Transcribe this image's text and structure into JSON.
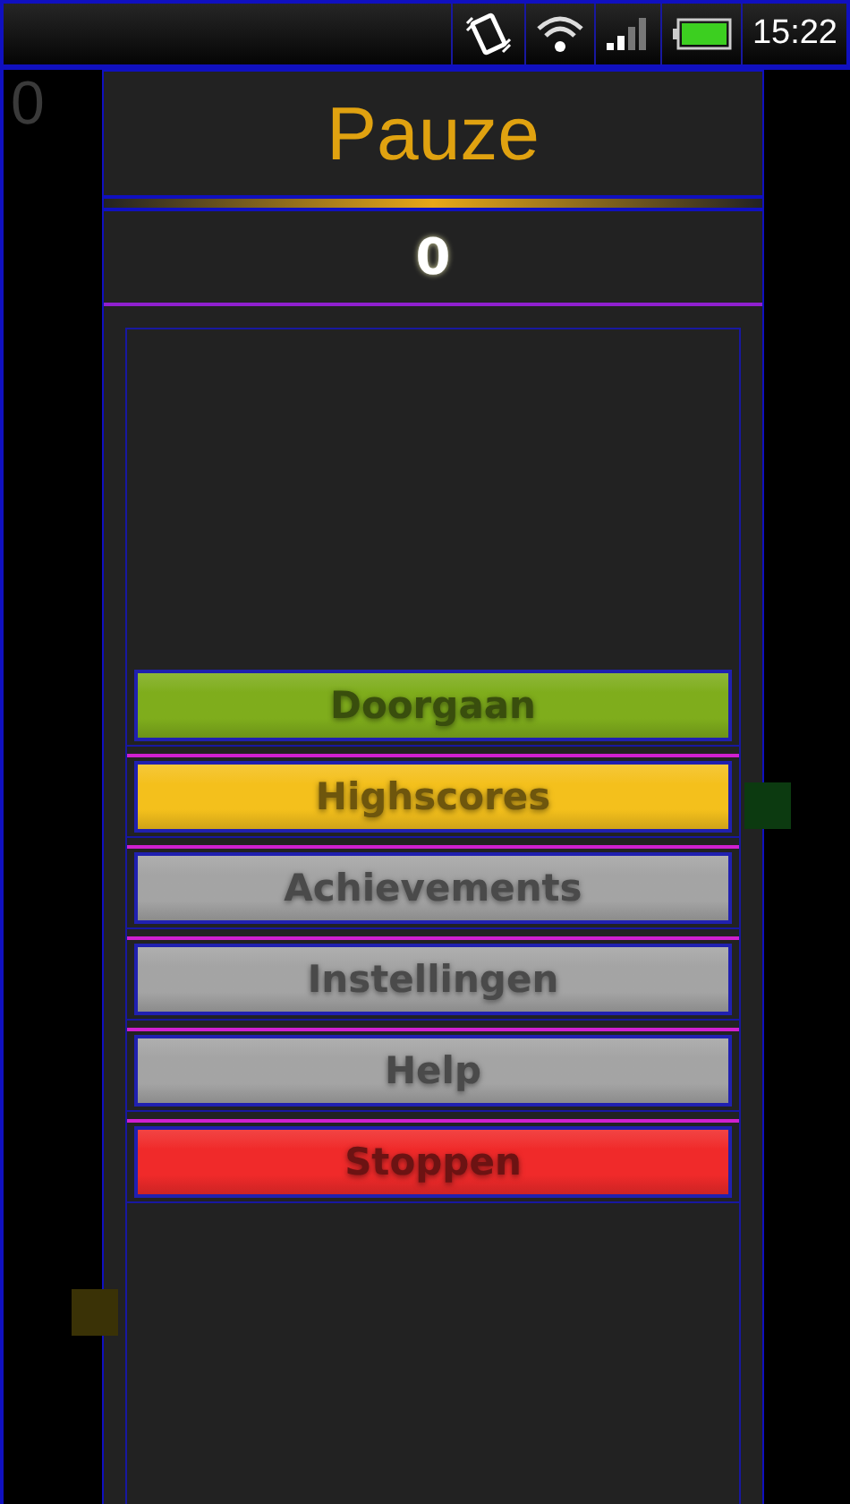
{
  "status_bar": {
    "time": "15:22"
  },
  "side_score": "0",
  "title": "Pauze",
  "score": "0",
  "menu": [
    {
      "label": "Doorgaan",
      "color": "#7fad1c"
    },
    {
      "label": "Highscores",
      "color": "#f4c01c"
    },
    {
      "label": "Achievements",
      "color": "#a4a4a4"
    },
    {
      "label": "Instellingen",
      "color": "#a4a4a4"
    },
    {
      "label": "Help",
      "color": "#a4a4a4"
    },
    {
      "label": "Stoppen",
      "color": "#f02a2a"
    }
  ]
}
